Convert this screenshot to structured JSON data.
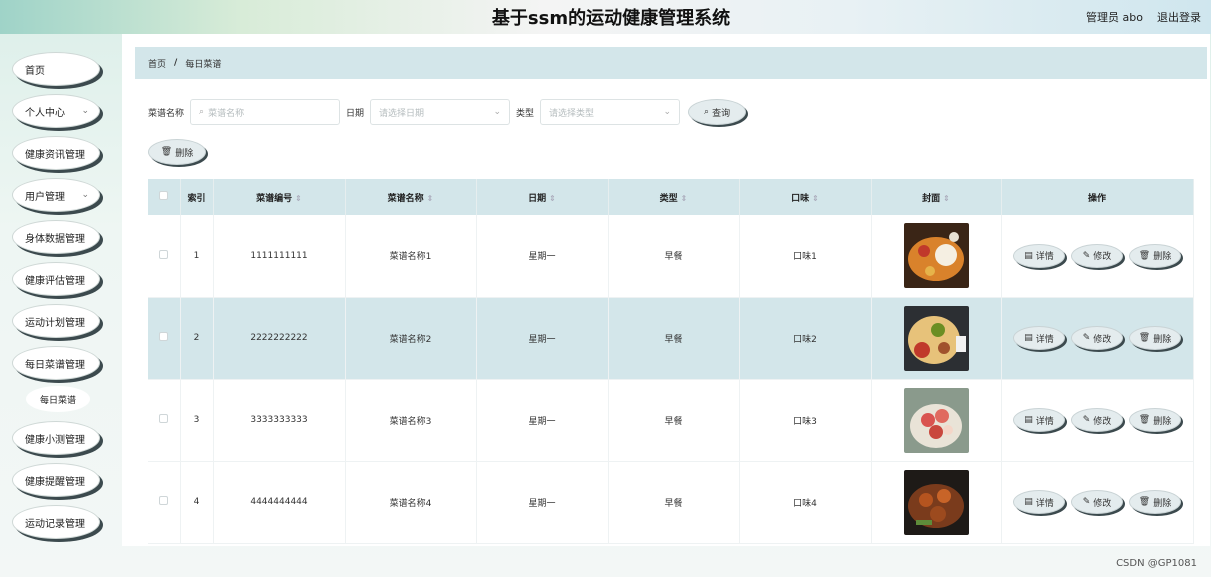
{
  "header": {
    "title": "基于ssm的运动健康管理系统",
    "user": "管理员 abo",
    "logout": "退出登录"
  },
  "sidebar": {
    "items": [
      {
        "label": "首页"
      },
      {
        "label": "个人中心"
      },
      {
        "label": "健康资讯管理"
      },
      {
        "label": "用户管理"
      },
      {
        "label": "身体数据管理"
      },
      {
        "label": "健康评估管理"
      },
      {
        "label": "运动计划管理"
      },
      {
        "label": "每日菜谱管理"
      },
      {
        "label": "健康小测管理"
      },
      {
        "label": "健康提醒管理"
      },
      {
        "label": "运动记录管理"
      }
    ],
    "submenu": {
      "label": "每日菜谱"
    }
  },
  "breadcrumb": {
    "home": "首页",
    "separator": "/",
    "current": "每日菜谱"
  },
  "search": {
    "name_label": "菜谱名称",
    "name_placeholder": "菜谱名称",
    "date_label": "日期",
    "date_placeholder": "请选择日期",
    "type_label": "类型",
    "type_placeholder": "请选择类型",
    "query_button": "查询"
  },
  "toolbar": {
    "delete_button": "删除"
  },
  "table": {
    "headers": [
      "索引",
      "菜谱编号",
      "菜谱名称",
      "日期",
      "类型",
      "口味",
      "封面",
      "操作"
    ],
    "rows": [
      {
        "index": "1",
        "code": "1111111111",
        "name": "菜谱名称1",
        "date": "星期一",
        "type": "早餐",
        "taste": "口味1"
      },
      {
        "index": "2",
        "code": "2222222222",
        "name": "菜谱名称2",
        "date": "星期一",
        "type": "早餐",
        "taste": "口味2"
      },
      {
        "index": "3",
        "code": "3333333333",
        "name": "菜谱名称3",
        "date": "星期一",
        "type": "早餐",
        "taste": "口味3"
      },
      {
        "index": "4",
        "code": "4444444444",
        "name": "菜谱名称4",
        "date": "星期一",
        "type": "早餐",
        "taste": "口味4"
      }
    ],
    "actions": {
      "detail": "详情",
      "edit": "修改",
      "delete": "删除"
    }
  },
  "watermark": "CSDN @GP1081",
  "colors": {
    "accent": "#d3e6ea",
    "panel": "#ffffff",
    "shadow": "#3c4a4e"
  },
  "icons": [
    "search-icon",
    "chevron-down-icon",
    "trash-icon",
    "document-icon",
    "pencil-icon",
    "sort-icon"
  ]
}
